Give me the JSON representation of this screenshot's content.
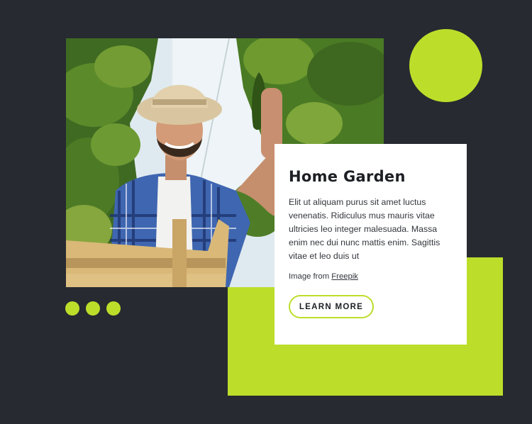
{
  "card": {
    "title": "Home Garden",
    "body": "Elit ut aliquam purus sit amet luctus venenatis. Ridiculus mus mauris vitae ultricies leo integer malesuada. Massa enim nec dui nunc mattis enim. Sagittis vitae et leo duis ut",
    "credit_prefix": "Image from ",
    "credit_link": "Freepik",
    "button_label": "LEARN MORE"
  },
  "colors": {
    "background": "#272a31",
    "accent": "#bcde2a",
    "card": "#ffffff",
    "text": "#1d1f24"
  },
  "image": {
    "subject": "smiling-farmer-holding-cucumber-in-greenhouse"
  }
}
